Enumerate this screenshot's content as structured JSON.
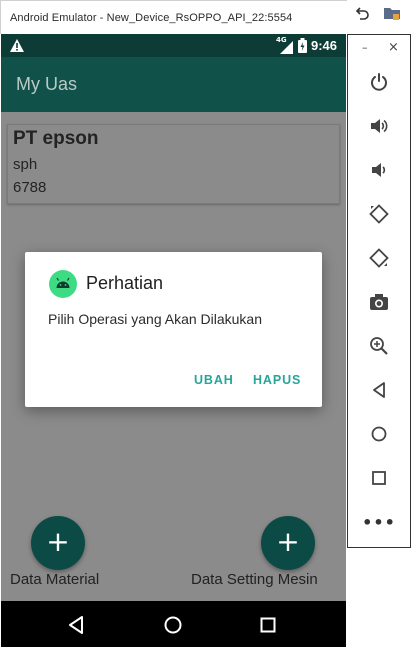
{
  "window": {
    "title": "Android Emulator - New_Device_RsOPPO_API_22:5554"
  },
  "status_bar": {
    "network": "4G",
    "time": "9:46"
  },
  "app_bar": {
    "title": "My Uas"
  },
  "card": {
    "name": "PT epson",
    "line1": "sph",
    "line2": "6788"
  },
  "fabs": {
    "left_label": "Data Material",
    "right_label": "Data Setting Mesin",
    "icon": "+"
  },
  "dialog": {
    "title": "Perhatian",
    "message": "Pilih Operasi yang Akan Dilakukan",
    "button_ubah": "UBAH",
    "button_hapus": "HAPUS"
  },
  "side_panel": {
    "minimize": "–",
    "close": "×",
    "more": "•••"
  },
  "colors": {
    "status_bar": "#0d3b35",
    "app_bar": "#10514a",
    "fab": "#0c4b45",
    "accent": "#26a69a",
    "dim_background": "#8b8b8b"
  }
}
